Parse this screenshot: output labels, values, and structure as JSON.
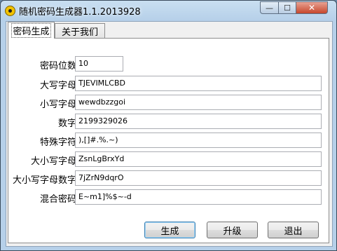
{
  "window": {
    "title": "随机密码生成器1.1.2013928",
    "minimize_glyph": "—",
    "maximize_glyph": "☐",
    "close_glyph": "✕"
  },
  "tabs": [
    {
      "label": "密码生成",
      "active": true
    },
    {
      "label": "关于我们",
      "active": false
    }
  ],
  "fields": {
    "length": {
      "label": "密码位数",
      "value": "10"
    },
    "upper": {
      "label": "大写字母",
      "value": "TJEVIMLCBD"
    },
    "lower": {
      "label": "小写字母",
      "value": "wewdbzzgoi"
    },
    "digits": {
      "label": "数字",
      "value": "2199329026"
    },
    "special": {
      "label": "特殊字符",
      "value": "),[]#.%.~)"
    },
    "mixed_case": {
      "label": "大小写字母",
      "value": "ZsnLgBrxYd"
    },
    "mixed_case_digits": {
      "label": "大小写字母数字",
      "value": "7jZrN9dqrO"
    },
    "mixed": {
      "label": "混合密码",
      "value": "E~m1]%$~-d"
    }
  },
  "buttons": {
    "generate": "生成",
    "upgrade": "升级",
    "exit": "退出"
  }
}
